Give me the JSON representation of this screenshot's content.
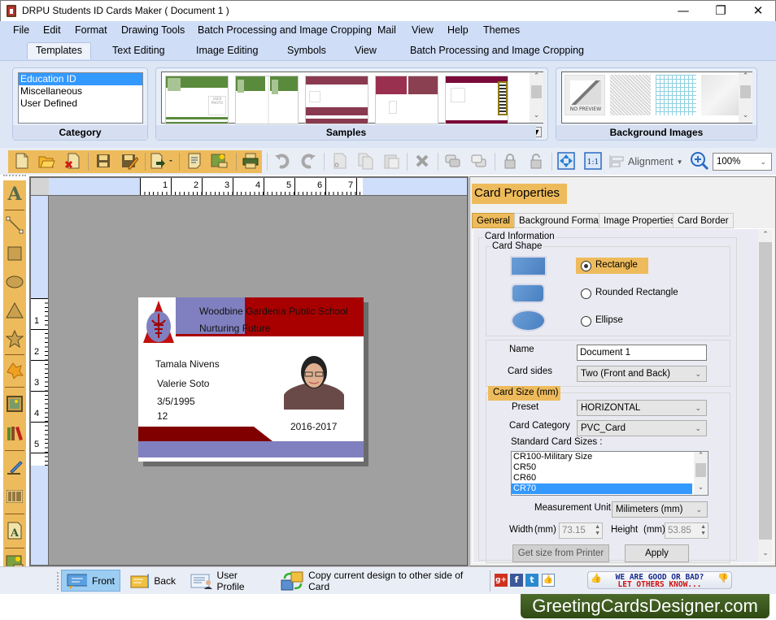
{
  "window": {
    "title": "DRPU Students ID Cards Maker ( Document 1 )",
    "controls": {
      "minimize": "—",
      "restore": "❐",
      "close": "✕"
    }
  },
  "menu": [
    "File",
    "Edit",
    "Format",
    "Drawing Tools",
    "Batch Processing and Image Cropping",
    "Mail",
    "View",
    "Help",
    "Themes"
  ],
  "ribbon_tabs": {
    "items": [
      "Templates",
      "Text Editing",
      "Image Editing",
      "Symbols",
      "View",
      "Batch Processing and Image Cropping"
    ],
    "active": "Templates"
  },
  "ribbon": {
    "category": {
      "label": "Category",
      "items": [
        "Education ID",
        "Miscellaneous",
        "User Defined"
      ],
      "selected": "Education ID"
    },
    "samples": {
      "label": "Samples",
      "thumb_text": "USER PHOTO",
      "colors": [
        "#5a8a3c",
        "#5a8a3c",
        "#8a3a50",
        "#9a3050",
        "#7a0a3a"
      ]
    },
    "background_images": {
      "label": "Background Images",
      "no_preview": "NO PREVIEW"
    }
  },
  "toolbar": {
    "icons": [
      "new-icon",
      "open-icon",
      "close-doc-icon",
      "save-icon",
      "save-as-icon",
      "export-icon",
      "properties-icon",
      "image-icon",
      "print-icon",
      "undo-icon",
      "redo-icon",
      "cut-icon",
      "copy-icon",
      "paste-icon",
      "delete-icon",
      "bring-front-icon",
      "send-back-icon",
      "lock-icon",
      "unlock-icon",
      "fit-icon",
      "actual-size-icon"
    ],
    "actual_size_label": "1:1",
    "alignment_label": "Alignment",
    "zoom_value": "100%"
  },
  "left_tools": [
    "text-tool",
    "line-tool",
    "rectangle-tool",
    "ellipse-tool",
    "triangle-tool",
    "star-tool",
    "shape-tool",
    "image-tool",
    "library-tool",
    "signature-tool",
    "barcode-tool",
    "watermark-tool",
    "background-tool"
  ],
  "rulers": {
    "top": [
      "1",
      "2",
      "3",
      "4",
      "5",
      "6",
      "7"
    ],
    "left": [
      "1",
      "2",
      "3",
      "4",
      "5"
    ]
  },
  "card": {
    "school": "Woodbine Gardenia Public School",
    "motto": "Nurturing Future",
    "name": "Tamala Nivens",
    "parent": "Valerie Soto",
    "dob": "3/5/1995",
    "class": "12",
    "session": "2016-2017",
    "colors": {
      "red": "#a80000",
      "purple": "#8080c0",
      "dark_red": "#800000"
    }
  },
  "card_properties": {
    "title": "Card Properties",
    "tabs": [
      "General",
      "Background Format",
      "Image Properties",
      "Card Border"
    ],
    "active_tab": "General",
    "card_information_label": "Card Information",
    "card_shape_label": "Card Shape",
    "shapes": [
      "Rectangle",
      "Rounded Rectangle",
      "Ellipse"
    ],
    "selected_shape": "Rectangle",
    "name_label": "Name",
    "name_value": "Document 1",
    "card_sides_label": "Card sides",
    "card_sides_value": "Two (Front and Back)",
    "card_size_label": "Card Size (mm)",
    "preset_label": "Preset",
    "preset_value": "HORIZONTAL",
    "card_category_label": "Card Category",
    "card_category_value": "PVC_Card",
    "standard_sizes_label": "Standard Card Sizes :",
    "standard_sizes": [
      "CR100-Military Size",
      "CR50",
      "CR60",
      "CR70"
    ],
    "selected_size": "CR70",
    "measurement_label": "Measurement Unit :",
    "measurement_value": "Milimeters (mm)",
    "width_label": "Width",
    "width_unit": "(mm)",
    "width_value": "73.15",
    "height_label": "Height",
    "height_unit": "(mm)",
    "height_value": "53.85",
    "get_size_button": "Get size from Printer",
    "apply_button": "Apply"
  },
  "bottom_bar": {
    "front": "Front",
    "back": "Back",
    "user_profile": "User Profile",
    "copy_design": "Copy current design to other side of Card",
    "feedback_line1": "WE ARE GOOD OR BAD?",
    "feedback_line2": "LET OTHERS KNOW..."
  },
  "branding": "GreetingCardsDesigner.com",
  "accent": "#eebb5c"
}
